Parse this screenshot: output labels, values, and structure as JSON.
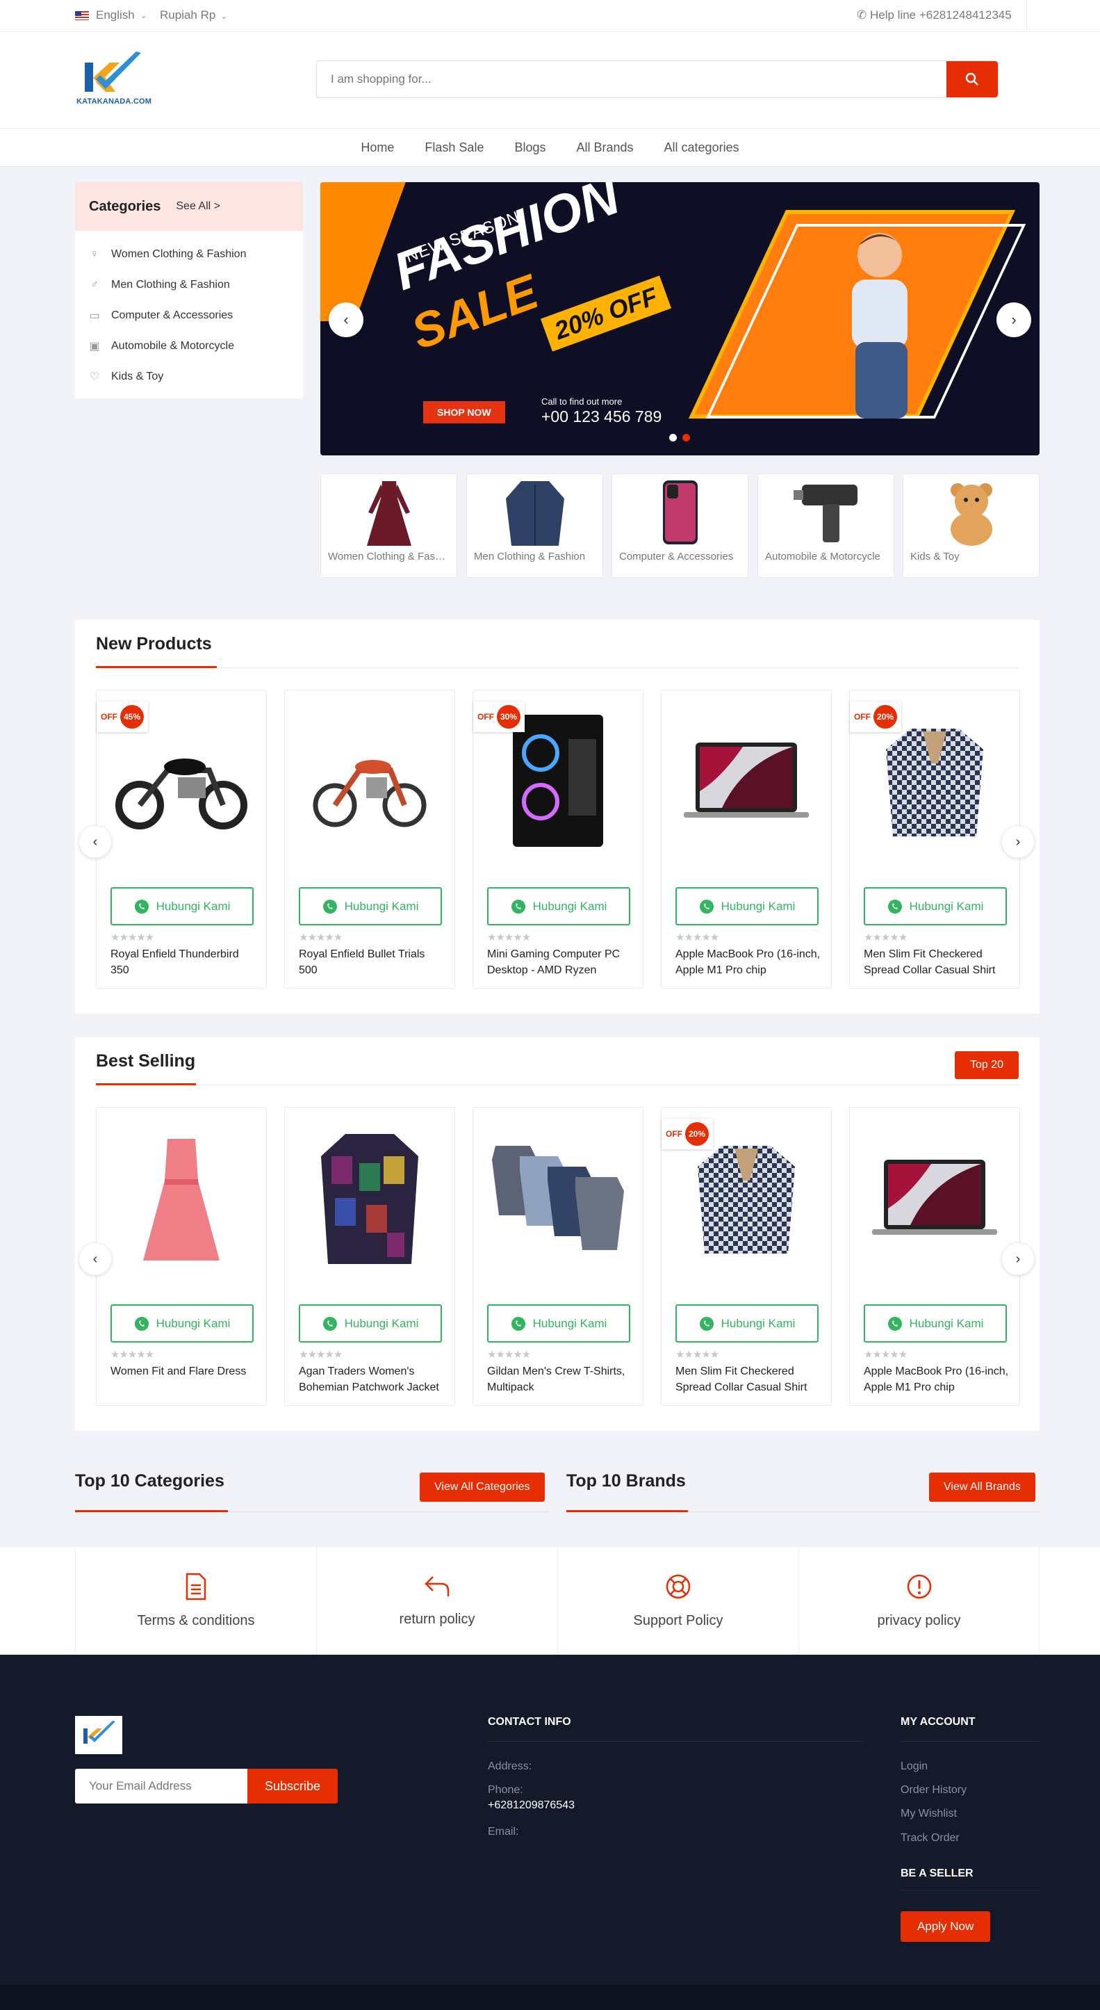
{
  "topbar": {
    "language": "English",
    "currency": "Rupiah Rp",
    "helpline": "Help line +6281248412345"
  },
  "header": {
    "logo_text": "KATAKANADA.COM",
    "search_placeholder": "I am shopping for..."
  },
  "nav": [
    "Home",
    "Flash Sale",
    "Blogs",
    "All Brands",
    "All categories"
  ],
  "categories": {
    "title": "Categories",
    "see_all": "See All >",
    "items": [
      "Women Clothing & Fashion",
      "Men Clothing & Fashion",
      "Computer & Accessories",
      "Automobile & Motorcycle",
      "Kids & Toy"
    ]
  },
  "banner": {
    "new_season": "NEW SEASON",
    "fashion": "FASHION",
    "sale": "SALE",
    "off": "20% OFF",
    "shop_now": "SHOP NOW",
    "call_text": "Call to find out more",
    "phone": "+00 123 456 789",
    "colors": {
      "accent": "#ff8a00",
      "background": "#0e0e24"
    }
  },
  "category_cards": [
    "Women Clothing & Fashion",
    "Men Clothing & Fashion",
    "Computer & Accessories",
    "Automobile & Motorcycle",
    "Kids & Toy"
  ],
  "new_products": {
    "title": "New Products",
    "contact_label": "Hubungi Kami",
    "products": [
      {
        "name": "Royal Enfield Thunderbird 350",
        "discount": "45%",
        "off_label": "OFF"
      },
      {
        "name": "Royal Enfield Bullet Trials 500",
        "discount": "",
        "off_label": ""
      },
      {
        "name": "Mini Gaming Computer PC Desktop - AMD Ryzen",
        "discount": "30%",
        "off_label": "OFF"
      },
      {
        "name": "Apple MacBook Pro (16-inch, Apple M1 Pro chip",
        "discount": "",
        "off_label": ""
      },
      {
        "name": "Men Slim Fit Checkered Spread Collar Casual Shirt",
        "discount": "20%",
        "off_label": "OFF"
      }
    ]
  },
  "best_selling": {
    "title": "Best Selling",
    "top_button": "Top 20",
    "contact_label": "Hubungi Kami",
    "products": [
      {
        "name": "Women Fit and Flare Dress",
        "discount": "",
        "off_label": ""
      },
      {
        "name": "Agan Traders Women's Bohemian Patchwork Jacket",
        "discount": "",
        "off_label": ""
      },
      {
        "name": "Gildan Men's Crew T-Shirts, Multipack",
        "discount": "",
        "off_label": ""
      },
      {
        "name": "Men Slim Fit Checkered Spread Collar Casual Shirt",
        "discount": "20%",
        "off_label": "OFF"
      },
      {
        "name": "Apple MacBook Pro (16-inch, Apple M1 Pro chip",
        "discount": "",
        "off_label": ""
      }
    ]
  },
  "top10": {
    "categories_title": "Top 10 Categories",
    "categories_button": "View All Categories",
    "brands_title": "Top 10 Brands",
    "brands_button": "View All Brands"
  },
  "policies": [
    "Terms & conditions",
    "return policy",
    "Support Policy",
    "privacy policy"
  ],
  "footer": {
    "email_placeholder": "Your Email Address",
    "subscribe": "Subscribe",
    "contact_title": "CONTACT INFO",
    "address_label": "Address:",
    "phone_label": "Phone:",
    "phone": "+6281209876543",
    "email_label": "Email:",
    "account_title": "MY ACCOUNT",
    "account_links": [
      "Login",
      "Order History",
      "My Wishlist",
      "Track Order"
    ],
    "seller_title": "BE A SELLER",
    "apply_now": "Apply Now"
  },
  "colors": {
    "primary": "#e62e04",
    "whatsapp": "#32b460",
    "footer_bg": "#141a2a"
  }
}
